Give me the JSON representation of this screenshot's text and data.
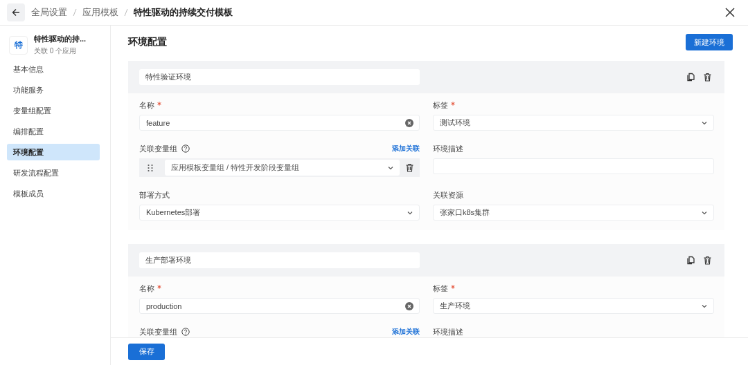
{
  "header": {
    "breadcrumb": [
      {
        "label": "全局设置",
        "current": false
      },
      {
        "label": "应用模板",
        "current": false
      },
      {
        "label": "特性驱动的持续交付模板",
        "current": true
      }
    ]
  },
  "template": {
    "avatar": "特",
    "name": "特性驱动的持...",
    "subtitle": "关联 0 个应用"
  },
  "menu": [
    {
      "label": "基本信息",
      "selected": false
    },
    {
      "label": "功能服务",
      "selected": false
    },
    {
      "label": "变量组配置",
      "selected": false
    },
    {
      "label": "编排配置",
      "selected": false
    },
    {
      "label": "环境配置",
      "selected": true
    },
    {
      "label": "研发流程配置",
      "selected": false
    },
    {
      "label": "模板成员",
      "selected": false
    }
  ],
  "section": {
    "title": "环境配置",
    "new_button": "新建环境"
  },
  "environments": [
    {
      "name": "特性验证环境",
      "fields": [
        {
          "kind": "input",
          "label": "名称",
          "required": true,
          "help": false,
          "clearable": true,
          "value": "feature"
        },
        {
          "kind": "select",
          "label": "标签",
          "required": true,
          "help": false,
          "value": "测试环境"
        },
        {
          "kind": "groups",
          "label": "关联变量组",
          "required": false,
          "help": true,
          "link": "添加关联",
          "items": [
            "应用模板变量组 / 特性开发阶段变量组"
          ]
        },
        {
          "kind": "input",
          "label": "环境描述",
          "required": false,
          "help": false,
          "clearable": false
        },
        {
          "kind": "select",
          "label": "部署方式",
          "required": false,
          "help": false,
          "value": "Kubernetes部署"
        },
        {
          "kind": "select",
          "label": "关联资源",
          "required": false,
          "help": false,
          "value": "张家口k8s集群"
        }
      ]
    },
    {
      "name": "生产部署环境",
      "fields": [
        {
          "kind": "input",
          "label": "名称",
          "required": true,
          "help": false,
          "clearable": true,
          "value": "production"
        },
        {
          "kind": "select",
          "label": "标签",
          "required": true,
          "help": false,
          "value": "生产环境"
        },
        {
          "kind": "groups",
          "label": "关联变量组",
          "required": false,
          "help": true,
          "link": "添加关联"
        },
        {
          "kind": "label",
          "label": "环境描述",
          "required": false,
          "help": false
        }
      ]
    }
  ],
  "save_button": "保存"
}
